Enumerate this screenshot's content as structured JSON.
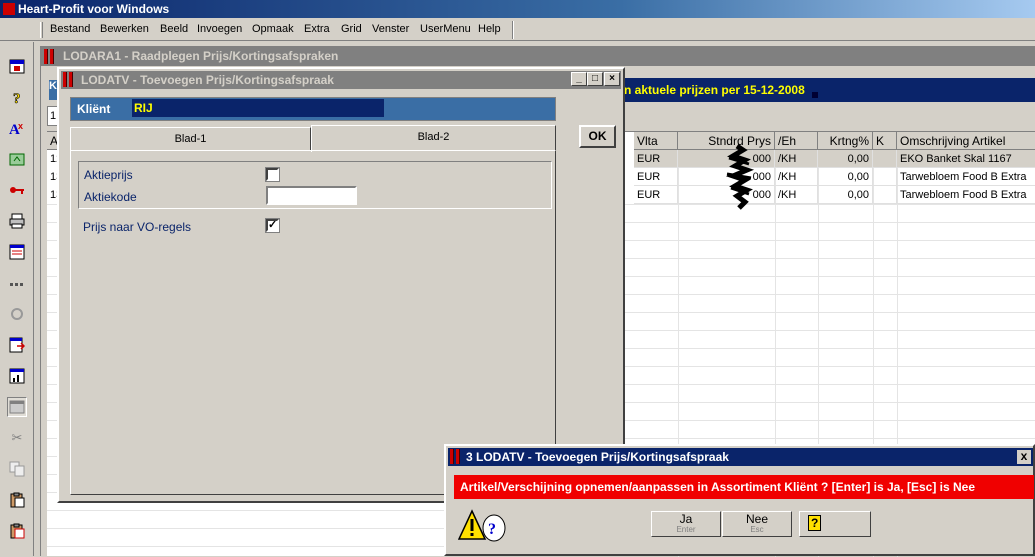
{
  "app": {
    "title": "Heart-Profit voor Windows"
  },
  "menu": [
    "Bestand",
    "Bewerken",
    "Beeld",
    "Invoegen",
    "Opmaak",
    "Extra",
    "Grid",
    "Venster",
    "UserMenu",
    "Help"
  ],
  "toolbar_icons": [
    "calendar-icon",
    "help-icon",
    "font-icon",
    "refresh-icon",
    "key-icon",
    "printer-icon",
    "form-icon",
    "dots-icon",
    "recycle-icon",
    "export-icon",
    "chart-icon",
    "window-icon",
    "scissors-icon",
    "copy-icon",
    "paste-icon",
    "clipboard-icon"
  ],
  "background_window": {
    "title": "LODARA1 - Raadplegen Prijs/Kortingsafspraken",
    "k_label": "K",
    "field_value": "1",
    "banner": "n aktuele prijzen per 15-12-2008",
    "columns": [
      "A",
      "Vlta",
      "Stndrd Prys",
      "/Eh",
      "Krtng%",
      "K",
      "Omschrijving Artikel"
    ],
    "rows": [
      {
        "a": "12",
        "vlta": "EUR",
        "prijs": "000",
        "eh": "/KH",
        "krtng": "0,00",
        "k": "",
        "oms": "EKO Banket Skal 1167"
      },
      {
        "a": "13",
        "vlta": "EUR",
        "prijs": "000",
        "eh": "/KH",
        "krtng": "0,00",
        "k": "",
        "oms": "Tarwebloem Food B Extra"
      },
      {
        "a": "13",
        "vlta": "EUR",
        "prijs": "000",
        "eh": "/KH",
        "krtng": "0,00",
        "k": "",
        "oms": "Tarwebloem Food B Extra"
      }
    ]
  },
  "dialog": {
    "title": "LODATV - Toevoegen Prijs/Kortingsafspraak",
    "client_label": "Kliënt",
    "client_value": "RIJ",
    "tabs": [
      "Blad-1",
      "Blad-2"
    ],
    "active_tab": "Blad-2",
    "aktieprijs_label": "Aktieprijs",
    "aktieprijs_checked": false,
    "aktiekode_label": "Aktiekode",
    "aktiekode_value": "",
    "vo_label": "Prijs naar VO-regels",
    "vo_checked": true,
    "ok_label": "OK",
    "check_mark": "✓"
  },
  "confirm": {
    "title": "3 LODATV - Toevoegen Prijs/Kortingsafspraak",
    "message": "Artikel/Verschijning opnemen/aanpassen in Assortiment Kliënt ?  [Enter] is Ja, [Esc] is Nee",
    "yes_label": "Ja",
    "yes_sub": "Enter",
    "no_label": "Nee",
    "no_sub": "Esc",
    "help_label": "?",
    "close_label": "x"
  }
}
